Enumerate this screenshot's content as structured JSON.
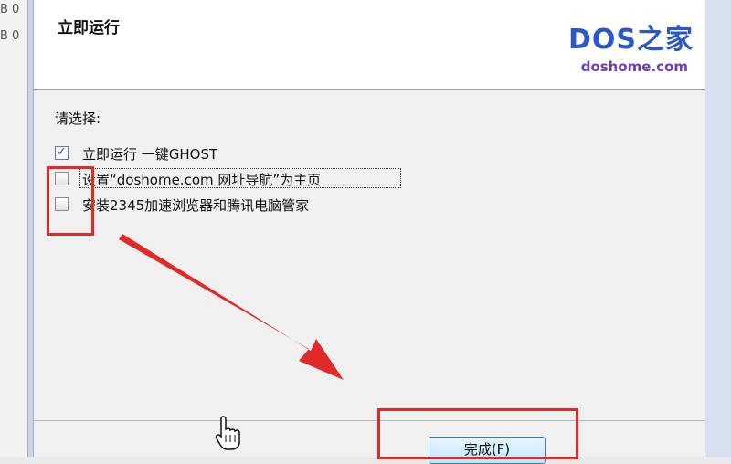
{
  "background_window": {
    "lines": [
      "B 0",
      "B 0"
    ]
  },
  "dialog": {
    "title": "立即运行",
    "logo": {
      "main": "DOS之家",
      "sub": "doshome.com"
    },
    "prompt": "请选择:",
    "options": [
      {
        "label": "立即运行 一键GHOST",
        "checked": true
      },
      {
        "label": "设置“doshome.com 网址导航”为主页",
        "checked": false
      },
      {
        "label": "安装2345加速浏览器和腾讯电脑管家",
        "checked": false
      }
    ],
    "finish_button": {
      "label": "完成(F)"
    }
  },
  "annotation": {
    "color": "#e02a2a"
  },
  "colors": {
    "logo_blue": "#2b59c3",
    "logo_purple": "#6b3fb5",
    "button_border": "#3c7fb1"
  },
  "icons": {
    "cursor": "hand-pointer-icon",
    "arrow": "red-arrow"
  }
}
